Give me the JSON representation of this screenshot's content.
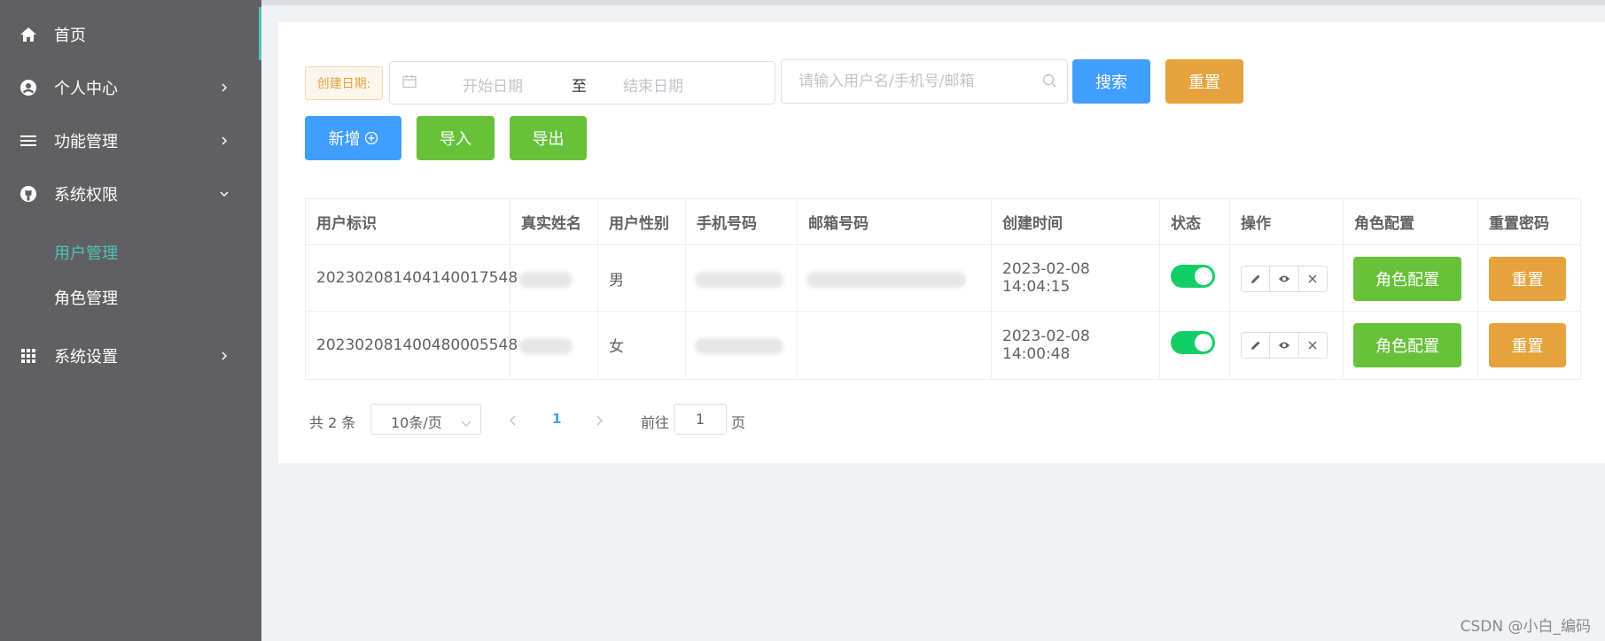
{
  "sidebar": {
    "items": [
      {
        "label": "首页",
        "icon": "home-icon"
      },
      {
        "label": "个人中心",
        "icon": "user-circle-icon"
      },
      {
        "label": "功能管理",
        "icon": "menu-lines-icon"
      },
      {
        "label": "系统权限",
        "icon": "github-icon"
      },
      {
        "label": "系统设置",
        "icon": "grid-icon"
      }
    ],
    "sub_items": [
      {
        "label": "用户管理",
        "active": true
      },
      {
        "label": "角色管理",
        "active": false
      }
    ],
    "accent_color": "#4fc3b5"
  },
  "filters": {
    "date_label": "创建日期:",
    "start_placeholder": "开始日期",
    "separator": "至",
    "end_placeholder": "结束日期",
    "search_placeholder": "请输入用户名/手机号/邮箱",
    "search_button": "搜索",
    "reset_button": "重置"
  },
  "actions": {
    "add_button": "新增",
    "import_button": "导入",
    "export_button": "导出"
  },
  "table": {
    "headers": [
      "用户标识",
      "真实姓名",
      "用户性别",
      "手机号码",
      "邮箱号码",
      "创建时间",
      "状态",
      "操作",
      "角色配置",
      "重置密码"
    ],
    "rows": [
      {
        "id": "202302081404140017548",
        "gender": "男",
        "created": "2023-02-08 14:04:15",
        "status_on": true,
        "role_button": "角色配置",
        "reset_button": "重置"
      },
      {
        "id": "202302081400480005548",
        "gender": "女",
        "created": "2023-02-08 14:00:48",
        "status_on": true,
        "role_button": "角色配置",
        "reset_button": "重置"
      }
    ]
  },
  "pagination": {
    "total_text": "共 2 条",
    "page_size": "10条/页",
    "current_page": "1",
    "goto_label": "前往",
    "goto_value": "1",
    "page_suffix": "页"
  },
  "watermark": "CSDN @小白_编码",
  "colors": {
    "primary": "#409eff",
    "warning": "#e6a23c",
    "success": "#67c23a",
    "switch_on": "#13ce66",
    "sidebar_bg": "#606062"
  }
}
